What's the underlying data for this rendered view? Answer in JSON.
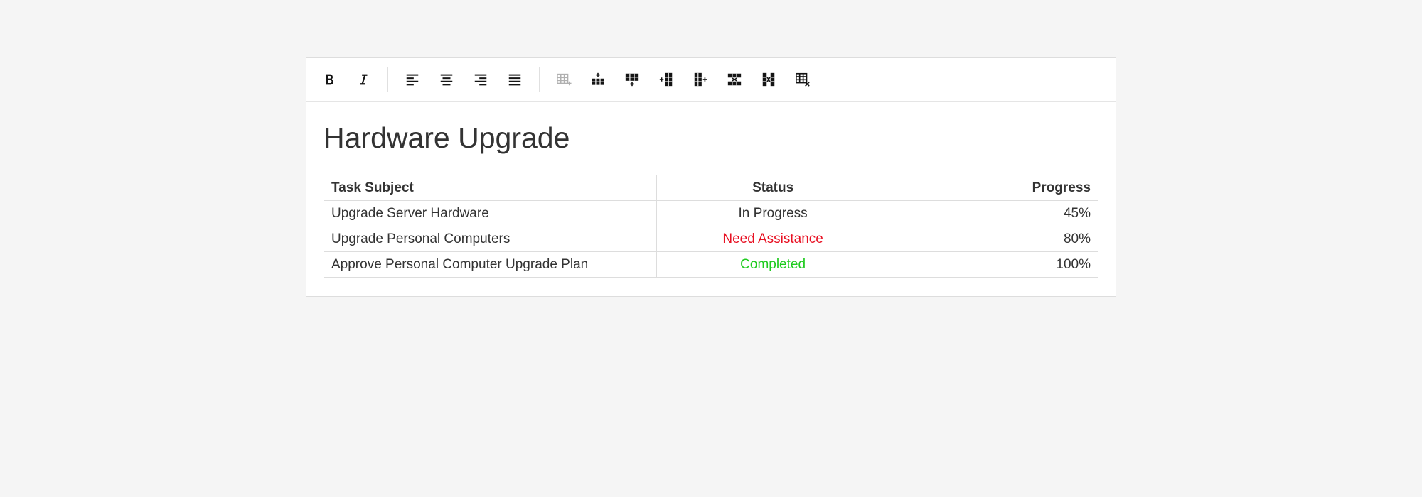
{
  "toolbar": {
    "groups": [
      [
        {
          "name": "bold-button",
          "icon": "bold",
          "disabled": false
        },
        {
          "name": "italic-button",
          "icon": "italic",
          "disabled": false
        }
      ],
      [
        {
          "name": "align-left-button",
          "icon": "align-left",
          "disabled": false
        },
        {
          "name": "align-center-button",
          "icon": "align-center",
          "disabled": false
        },
        {
          "name": "align-right-button",
          "icon": "align-right",
          "disabled": false
        },
        {
          "name": "align-justify-button",
          "icon": "align-justify",
          "disabled": false
        }
      ],
      [
        {
          "name": "insert-table-button",
          "icon": "insert-table",
          "disabled": true
        },
        {
          "name": "insert-row-above-button",
          "icon": "insert-row-above",
          "disabled": false
        },
        {
          "name": "insert-row-below-button",
          "icon": "insert-row-below",
          "disabled": false
        },
        {
          "name": "insert-column-left-button",
          "icon": "insert-column-left",
          "disabled": false
        },
        {
          "name": "insert-column-right-button",
          "icon": "insert-column-right",
          "disabled": false
        },
        {
          "name": "delete-row-button",
          "icon": "delete-row",
          "disabled": false
        },
        {
          "name": "delete-column-button",
          "icon": "delete-column",
          "disabled": false
        },
        {
          "name": "delete-table-button",
          "icon": "delete-table",
          "disabled": false
        }
      ]
    ]
  },
  "document": {
    "title": "Hardware Upgrade",
    "table": {
      "headers": [
        "Task Subject",
        "Status",
        "Progress"
      ],
      "rows": [
        {
          "subject": "Upgrade Server Hardware",
          "status": "In Progress",
          "status_class": "",
          "progress": "45%"
        },
        {
          "subject": "Upgrade Personal Computers",
          "status": "Need Assistance",
          "status_class": "status-red",
          "progress": "80%"
        },
        {
          "subject": "Approve Personal Computer Upgrade Plan",
          "status": "Completed",
          "status_class": "status-green",
          "progress": "100%"
        }
      ]
    }
  }
}
